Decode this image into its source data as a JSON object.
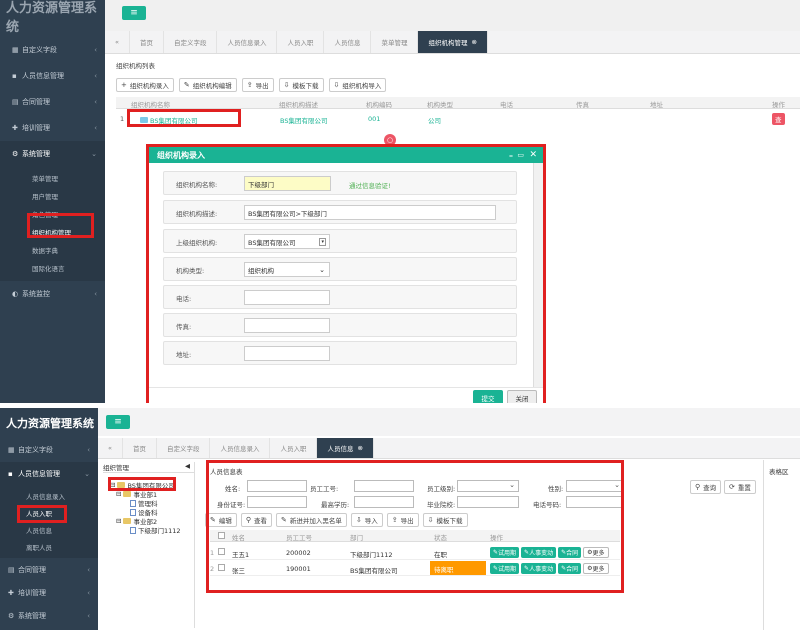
{
  "top": {
    "brand": "人力资源管理系统",
    "tabs": [
      "首页",
      "自定义字段",
      "人员信息录入",
      "人员入职",
      "人员信息",
      "菜单管理",
      "组织机构管理"
    ],
    "sidebar": [
      {
        "label": "自定义字段",
        "icon": "grid-icon"
      },
      {
        "label": "人员信息管理",
        "icon": "user-icon"
      },
      {
        "label": "合同管理",
        "icon": "doc-icon"
      },
      {
        "label": "培训管理",
        "icon": "pin-icon"
      },
      {
        "label": "系统管理",
        "icon": "gear-icon"
      }
    ],
    "sys_subitems": [
      "菜单管理",
      "用户管理",
      "角色管理",
      "组织机构管理",
      "数据字典",
      "国际化语言"
    ],
    "sys_monitor": "系统监控",
    "panel_title": "组织机构列表",
    "toolbar": [
      "组织机构录入",
      "组织机构编辑",
      "导出",
      "模板下载",
      "组织机构导入"
    ],
    "columns": [
      "组织机构名称",
      "组织机构描述",
      "机构编码",
      "机构类型",
      "电话",
      "传真",
      "地址",
      "操作"
    ],
    "row": {
      "num": "1",
      "name": "BS集团有限公司",
      "desc": "BS集团有限公司",
      "code": "001",
      "type": "公司",
      "op": "查"
    },
    "modal": {
      "title": "组织机构录入",
      "fields": {
        "name_label": "组织机构名称:",
        "name_value": "下级部门",
        "valid_text": "通过信息验证!",
        "desc_label": "组织机构描述:",
        "desc_value": "BS集团有限公司>下级部门",
        "parent_label": "上级组织机构:",
        "parent_value": "BS集团有限公司",
        "type_label": "机构类型:",
        "type_value": "组织机构",
        "phone_label": "电话:",
        "fax_label": "传真:",
        "addr_label": "地址:"
      },
      "submit": "提交",
      "close": "关闭"
    }
  },
  "bottom": {
    "brand": "人力资源管理系统",
    "tabs": [
      "首页",
      "自定义字段",
      "人员信息录入",
      "人员入职",
      "人员信息"
    ],
    "sidebar": [
      {
        "label": "自定义字段",
        "icon": "grid-icon"
      },
      {
        "label": "人员信息管理",
        "icon": "user-icon"
      }
    ],
    "person_subitems": [
      "人员信息录入",
      "人员入职",
      "人员信息",
      "离职人员"
    ],
    "sidebar_after": [
      {
        "label": "合同管理",
        "icon": "doc-icon"
      },
      {
        "label": "培训管理",
        "icon": "pin-icon"
      },
      {
        "label": "系统管理",
        "icon": "gear-icon"
      }
    ],
    "org_title": "组织管理",
    "tree": [
      {
        "label": "BS集团有限公司",
        "kind": "folder",
        "level": 0
      },
      {
        "label": "事业部1",
        "kind": "folder",
        "level": 1
      },
      {
        "label": "管理科",
        "kind": "file",
        "level": 2
      },
      {
        "label": "设备科",
        "kind": "file",
        "level": 2
      },
      {
        "label": "事业部2",
        "kind": "folder",
        "level": 1
      },
      {
        "label": "下级部门1112",
        "kind": "file",
        "level": 2
      }
    ],
    "info_title": "人员信息表",
    "right_hint": "表格区",
    "query": {
      "name": "姓名:",
      "empno": "员工工号:",
      "level": "员工级别:",
      "gender": "性别:",
      "idcard": "身份证号:",
      "edu": "最高学历:",
      "school": "毕业院校:",
      "phone": "电话号码:",
      "search": "查询",
      "reset": "重置"
    },
    "toolbar": [
      "编辑",
      "查看",
      "新进并加入黑名单",
      "导入",
      "导出",
      "模板下载"
    ],
    "columns": [
      "",
      "姓名",
      "员工工号",
      "部门",
      "状态",
      "操作"
    ],
    "rows": [
      {
        "num": "1",
        "name": "王五1",
        "empno": "200002",
        "dept": "下级部门1112",
        "status": "在职",
        "status_color": "#ffffff"
      },
      {
        "num": "2",
        "name": "张三",
        "empno": "190001",
        "dept": "BS集团有限公司",
        "status": "待离职",
        "status_color": "#ff9900"
      }
    ],
    "actions": [
      "试用期",
      "人事变动",
      "合同",
      "更多"
    ]
  }
}
